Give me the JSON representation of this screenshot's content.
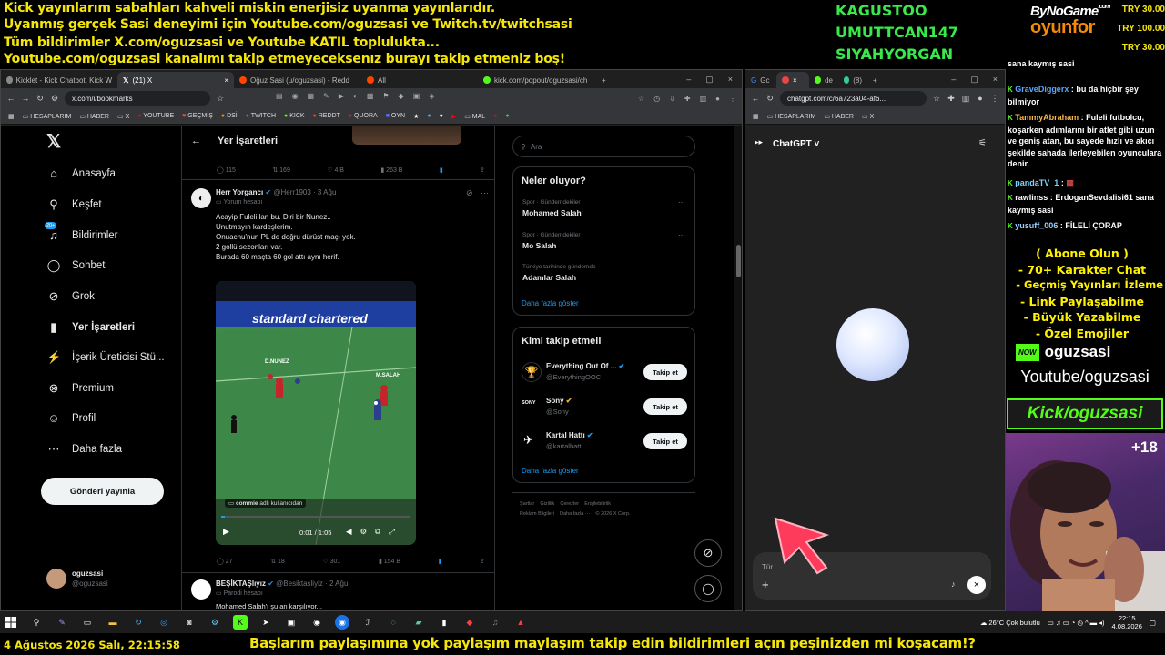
{
  "overlay": {
    "lines": [
      "Kick yayınlarım sabahları kahveli miskin enerjisiz uyanma yayınlarıdır.",
      "Uyanmış gerçek Sasi deneyimi için Youtube.com/oguzsasi ve Twitch.tv/twitchsasi",
      "Tüm bildirimler X.com/oguzsasi ve Youtube KATIL toplulukta...",
      "Youtube.com/oguzsasi kanalımı takip etmeyeceksenız burayı takip etmeniz boş!"
    ],
    "names": [
      "KAGUSTOO",
      "UMUTTCAN147",
      "SIYAHYORGAN"
    ],
    "brand_top": "ByNoGame",
    "brand_com": ".com",
    "brand_bottom": "oyunfor",
    "donations": [
      "TRY 30.00",
      "TRY 100.00",
      "TRY 30.00"
    ],
    "bottom_date": "4 Ağustos 2026 Salı, 22:15:58",
    "bottom_ticker": "Başlarım paylaşımına yok paylaşım maylaşım takip edin bildirimleri açın peşinizden mi koşacam!?"
  },
  "browser_left": {
    "tabs": [
      "Kicklet - Kick Chatbot, Kick W",
      "(21) X",
      "Oğuz Sasi (u/oguzsasi) - Redd",
      "All",
      "kick.com/popout/oguzsasi/ch"
    ],
    "url": "x.com/i/bookmarks",
    "bookmarks": [
      "HESAPLARIM",
      "HABER",
      "X",
      "YOUTUBE",
      "GEÇMİŞ",
      "DSİ",
      "TWITCH",
      "KICK",
      "REDDT",
      "QUORA",
      "OYN",
      "MAL"
    ]
  },
  "browser_right": {
    "tabs": [
      "Gc",
      "de",
      "(8)"
    ],
    "url": "chatgpt.com/c/6a723a04-af6...",
    "bookmarks": [
      "HESAPLARIM",
      "HABER",
      "X"
    ]
  },
  "x": {
    "nav": [
      {
        "icon": "home-icon",
        "glyph": "⌂",
        "label": "Anasayfa"
      },
      {
        "icon": "search-icon",
        "glyph": "⚲",
        "label": "Keşfet"
      },
      {
        "icon": "bell-icon",
        "glyph": "🔔",
        "label": "Bildirimler"
      },
      {
        "icon": "chat-icon",
        "glyph": "◯",
        "label": "Sohbet"
      },
      {
        "icon": "grok-icon",
        "glyph": "⊘",
        "label": "Grok"
      },
      {
        "icon": "bookmark-icon",
        "glyph": "▮",
        "label": "Yer İşaretleri"
      },
      {
        "icon": "creator-icon",
        "glyph": "⚡",
        "label": "İçerik Üreticisi Stü..."
      },
      {
        "icon": "premium-icon",
        "glyph": "⊗",
        "label": "Premium"
      },
      {
        "icon": "profile-icon",
        "glyph": "☺",
        "label": "Profil"
      },
      {
        "icon": "more-icon",
        "glyph": "⋯",
        "label": "Daha fazla"
      }
    ],
    "badge": "20+",
    "post_button": "Gönderi yayınla",
    "user_name": "oguzsasi",
    "user_handle": "@oguzsasi",
    "page_title": "Yer İşaretleri",
    "top_stats": [
      "115",
      "169",
      "4 B",
      "263 B"
    ],
    "tweet": {
      "author": "Herr Yorgancı",
      "handle": "@Herr1903 · 3 Ağu",
      "sub": "Yorum hesabı",
      "lines": [
        "Acayip Fuleli lan bu. Diri bir Nunez..",
        "Unutmayın kardeşlerim.",
        "Onuachu'nun PL de doğru dürüst maçı yok.",
        "2 gollü sezonları var.",
        "Burada 60 maçta 60 gol attı aynı herif."
      ],
      "video_banner": "standard chartered",
      "player1": "D.NUNEZ",
      "player2": "M.SALAH",
      "video_credit": "adlı kullanıcıdan",
      "video_credit_user": "commie",
      "video_time": "0:01 / 1:05",
      "stats": [
        "27",
        "18",
        "301",
        "154 B"
      ]
    },
    "tweet2": {
      "author": "BEŞİKTAŞlıyız",
      "handle": "@Besiktasliyiz · 2 Ağu",
      "sub": "Parodi hesabı",
      "line": "Mohamed Salah'ı şu an karşılıyor..."
    },
    "search_placeholder": "Ara",
    "trends_title": "Neler oluyor?",
    "trends": [
      {
        "meta": "Spor · Gündemdekiler",
        "name": "Mohamed Salah"
      },
      {
        "meta": "Spor · Gündemdekiler",
        "name": "Mo Salah"
      },
      {
        "meta": "Türkiye tarihinde gündemde",
        "name": "Adamlar Salah"
      }
    ],
    "show_more": "Daha fazla göster",
    "wtf_title": "Kimi takip etmeli",
    "wtf": [
      {
        "name": "Everything Out Of ...",
        "handle": "@EverythingOOC",
        "color": "#c9a25a"
      },
      {
        "name": "Sony",
        "handle": "@Sony",
        "color": "#ffffff"
      },
      {
        "name": "Kartal Hattı",
        "handle": "@kartalhatti",
        "color": "#ffffff"
      }
    ],
    "follow_label": "Takip et",
    "footer": [
      "Şartlar",
      "Gizlilik",
      "Çerezler",
      "Erişilebilirlik",
      "Reklam Bilgileri",
      "Daha fazla ···",
      "© 2026 X Corp."
    ]
  },
  "chatgpt": {
    "title": "ChatGPT",
    "input_placeholder": "Tür"
  },
  "chat": {
    "messages": [
      {
        "user": "",
        "text": "sana kaymış sasi"
      },
      {
        "user": "GraveDiggerx",
        "text": "bu da hiçbir şey bilmiyor"
      },
      {
        "user": "TammyAbraham",
        "text": "Fuleli futbolcu, koşarken adımlarını bir atlet gibi uzun ve geniş atan, bu sayede hızlı ve akıcı şekilde sahada ilerleyebilen oyunculara denir."
      },
      {
        "user": "pandaTV_1",
        "text": ""
      },
      {
        "user": "rawlinss",
        "text": "ErdoganSevdalisi61 sana kaymış sasi"
      },
      {
        "user": "yusuff_006",
        "text": "FİLELİ ÇORAP"
      }
    ],
    "promo": [
      "( Abone Olun )",
      "- 70+ Karakter Chat",
      "- Geçmiş Yayınları İzleme",
      "- Link Paylaşabilme",
      "- Büyük Yazabilme",
      "- Özel Emojiler"
    ],
    "now_label": "NOW",
    "now_user": "oguzsasi",
    "youtube": "Youtube/oguzsasi",
    "kick": "Kick/oguzsasi",
    "plus": "+18"
  },
  "taskbar": {
    "weather": "26°C  Çok bulutlu",
    "time": "22:15",
    "date": "4.08.2026"
  }
}
